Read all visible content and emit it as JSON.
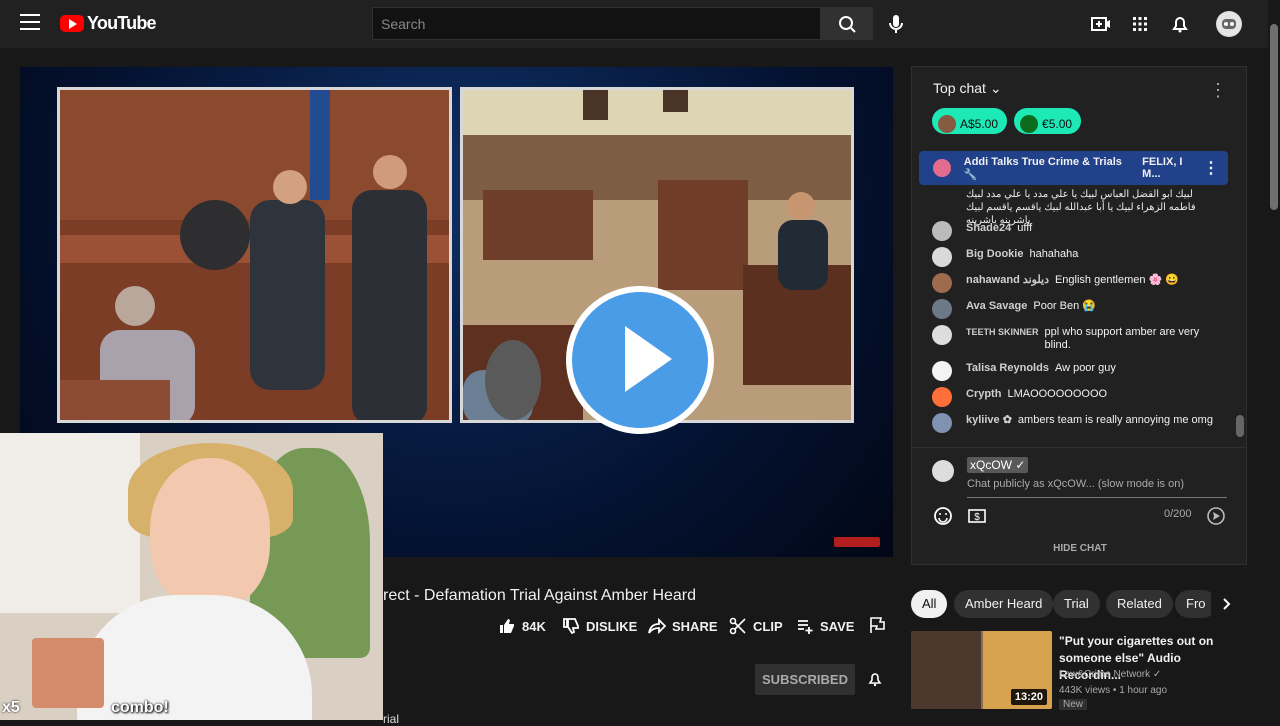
{
  "app": {
    "logo_text": "YouTube",
    "brand_color": "#ff0000"
  },
  "header": {
    "search_placeholder": "Search",
    "icons": [
      "menu-icon",
      "search-icon",
      "mic-icon",
      "create-icon",
      "apps-icon",
      "notifications-icon",
      "avatar"
    ]
  },
  "video": {
    "title": "rect - Defamation Trial Against Amber Heard",
    "overlay_combo": "combo!",
    "overlay_multiplier": "x5",
    "partial_text": "rial",
    "actions": {
      "like_count": "84K",
      "dislike": "DISLIKE",
      "share": "SHARE",
      "clip": "CLIP",
      "save": "SAVE"
    },
    "subscribe_label": "SUBSCRIBED"
  },
  "chat": {
    "mode": "Top chat",
    "tickers": [
      {
        "amount": "A$5.00",
        "color": "#1de9b6"
      },
      {
        "amount": "€5.00",
        "color": "#1de9b6"
      }
    ],
    "pinned_author": "Addi Talks True Crime & Trials 🔧",
    "pinned_text": "FELIX, I M...",
    "arabic_text": "لبيك ابو الفضل العباس لبيك يا علي مدد يا علي مدد لبيك فاطمه الزهراء لبيك يا أبا عبدالله لبيك ياقسم ياقسم لبيك ياشرينه ياشرينه",
    "messages": [
      {
        "author": "Shade24",
        "text": "ufff",
        "avatar_color": "#bbbbbb"
      },
      {
        "author": "Big Dookie",
        "text": "hahahaha",
        "avatar_color": "#d9d9d9"
      },
      {
        "author": "nahawand ديلوند",
        "text": "English gentlemen 🌸 😀",
        "avatar_color": "#9f6b4e"
      },
      {
        "author": "Ava Savage",
        "text": "Poor Ben 😭",
        "avatar_color": "#6c7a88"
      },
      {
        "author": "TEETH SKINNER",
        "text": "ppl who support amber are very blind.",
        "avatar_color": "#dddddd"
      },
      {
        "author": "Talisa Reynolds",
        "text": "Aw poor guy",
        "avatar_color": "#f3f3f3"
      },
      {
        "author": "Crypth",
        "text": "LMAOOOOOOOOO",
        "avatar_color": "#ff6f3a"
      },
      {
        "author": "kyliive ✿",
        "text": "ambers team is really annoying me omg",
        "avatar_color": "#7f93b0"
      }
    ],
    "current_user": "xQcOW ✓",
    "input_placeholder": "Chat publicly as xQcOW... (slow mode is on)",
    "char_counter": "0/200",
    "hide_chat": "HIDE CHAT"
  },
  "filters": [
    "All",
    "Amber Heard",
    "Trial",
    "Related",
    "Fro"
  ],
  "related": {
    "title": "\"Put your cigarettes out on someone else\" Audio Recordin...",
    "channel": "Law&Crime Network ✓",
    "meta": "443K views • 1 hour ago",
    "duration": "13:20",
    "badge": "New"
  }
}
